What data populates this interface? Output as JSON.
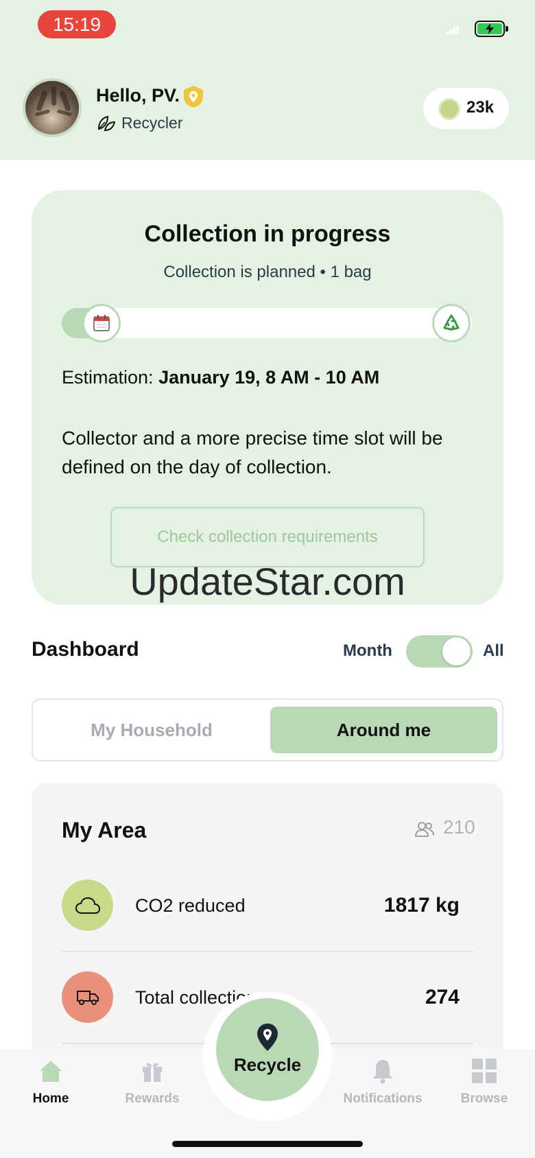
{
  "status_bar": {
    "time": "15:19"
  },
  "header": {
    "greeting": "Hello, PV.",
    "role": "Recycler",
    "points": "23k",
    "icons": {
      "avatar": "cat-photo-avatar",
      "badge": "shield-badge-icon",
      "role": "leaves-icon",
      "points": "coin-icon"
    }
  },
  "collection": {
    "title": "Collection in progress",
    "subtitle": "Collection is planned • 1 bag",
    "progress": 0.1,
    "estimation_label": "Estimation:",
    "estimation_value": "January 19, 8 AM - 10 AM",
    "note": "Collector and a more precise time slot will be defined on the day of collection.",
    "requirements_button": "Check collection requirements",
    "watermark": "UpdateStar.com"
  },
  "dashboard": {
    "title": "Dashboard",
    "toggle_left": "Month",
    "toggle_right": "All",
    "toggle_state": "All",
    "segments": [
      {
        "label": "My Household",
        "selected": false
      },
      {
        "label": "Around me",
        "selected": true
      }
    ],
    "area": {
      "title": "My Area",
      "people_count": "210",
      "stats": [
        {
          "label": "CO2 reduced",
          "value": "1817 kg",
          "icon": "cloud-icon",
          "color": "#c8d98a"
        },
        {
          "label": "Total collections",
          "value": "274",
          "icon": "truck-icon",
          "color": "#e8907a"
        }
      ]
    }
  },
  "nav": {
    "items": [
      {
        "label": "Home",
        "active": true,
        "icon": "home-icon"
      },
      {
        "label": "Rewards",
        "active": false,
        "icon": "gift-icon"
      },
      {
        "label": "Notifications",
        "active": false,
        "icon": "bell-icon"
      },
      {
        "label": "Browse",
        "active": false,
        "icon": "grid-icon"
      }
    ],
    "fab_label": "Recycle"
  },
  "colors": {
    "accent": "#b8d8b6",
    "header_bg": "#e3f2e2",
    "status_pill": "#e8453c"
  }
}
